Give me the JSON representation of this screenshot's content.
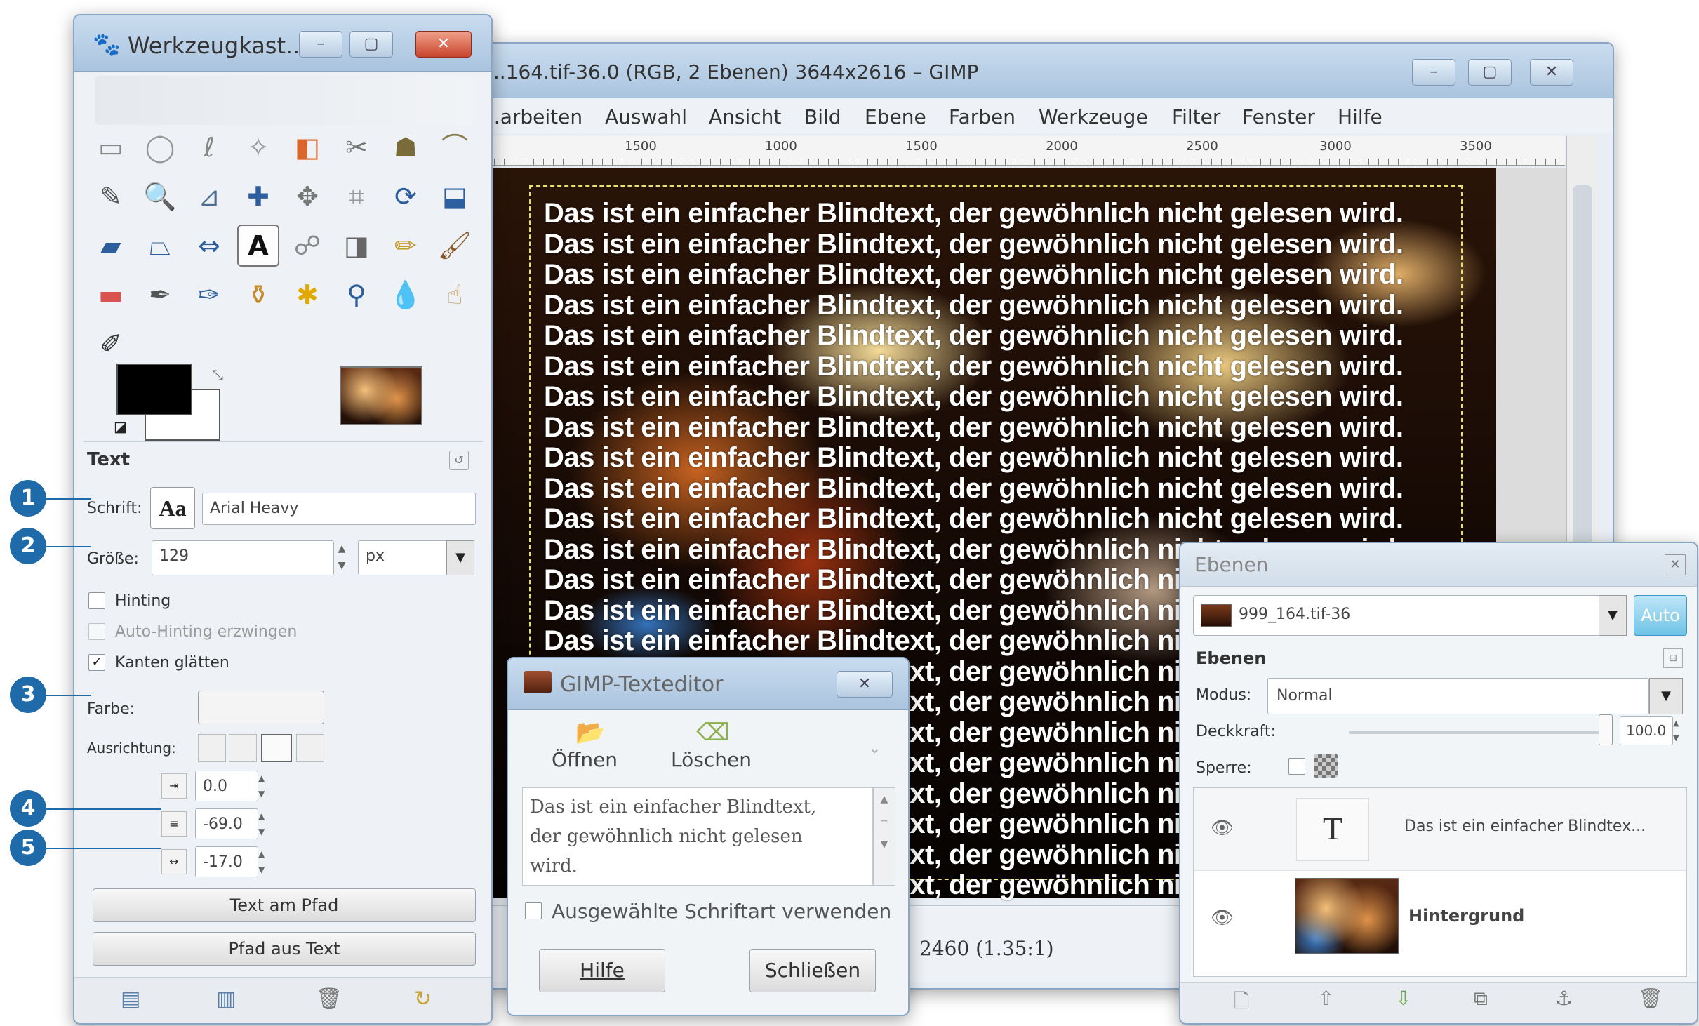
{
  "toolbox": {
    "title": "Werkzeugkast...",
    "text_section_title": "Text",
    "font_label": "Schrift:",
    "font_preview": "Aa",
    "font_value": "Arial Heavy",
    "size_label": "Größe:",
    "size_value": "129",
    "size_unit": "px",
    "hinting_label": "Hinting",
    "autohinting_label": "Auto-Hinting erzwingen",
    "antialias_label": "Kanten glätten",
    "color_label": "Farbe:",
    "justify_label": "Ausrichtung:",
    "indent_value": "0.0",
    "line_spacing_value": "-69.0",
    "letter_spacing_value": "-17.0",
    "text_along_path_label": "Text am Pfad",
    "path_from_text_label": "Pfad aus Text"
  },
  "callouts": [
    "1",
    "2",
    "3",
    "4",
    "5"
  ],
  "main_window": {
    "title": "...164.tif-36.0 (RGB, 2 Ebenen) 3644x2616 – GIMP",
    "menu": [
      "...arbeiten",
      "Auswahl",
      "Ansicht",
      "Bild",
      "Ebene",
      "Farben",
      "Werkzeuge",
      "Filter",
      "Fenster",
      "Hilfe"
    ],
    "ruler_labels": [
      "1500",
      "1000",
      "1500",
      "2000",
      "2500",
      "3000",
      "3500"
    ],
    "canvas_text_line": "Das ist ein einfacher Blindtext, der gewöhnlich nicht gelesen wird.",
    "canvas_line_count": 23,
    "status_text": "2460  (1.35:1)"
  },
  "text_editor": {
    "title": "GIMP-Texteditor",
    "open_label": "Öffnen",
    "clear_label": "Löschen",
    "content_line1": "Das ist ein einfacher Blindtext,",
    "content_line2": "der gewöhnlich nicht gelesen",
    "content_line3": "wird.",
    "use_font_label": "Ausgewählte Schriftart verwenden",
    "help_label": "Hilfe",
    "close_label": "Schließen"
  },
  "layers": {
    "title": "Ebenen",
    "image_select": "999_164.tif-36",
    "auto_label": "Auto",
    "section_label": "Ebenen",
    "mode_label": "Modus:",
    "mode_value": "Normal",
    "opacity_label": "Deckkraft:",
    "opacity_value": "100.0",
    "lock_label": "Sperre:",
    "layer_list": [
      {
        "name": "Das ist ein einfacher Blindtex..."
      },
      {
        "name": "Hintergrund"
      }
    ]
  },
  "colors": {
    "accent": "#1f6aa8",
    "foreground": "#000000",
    "background": "#ffffff"
  }
}
